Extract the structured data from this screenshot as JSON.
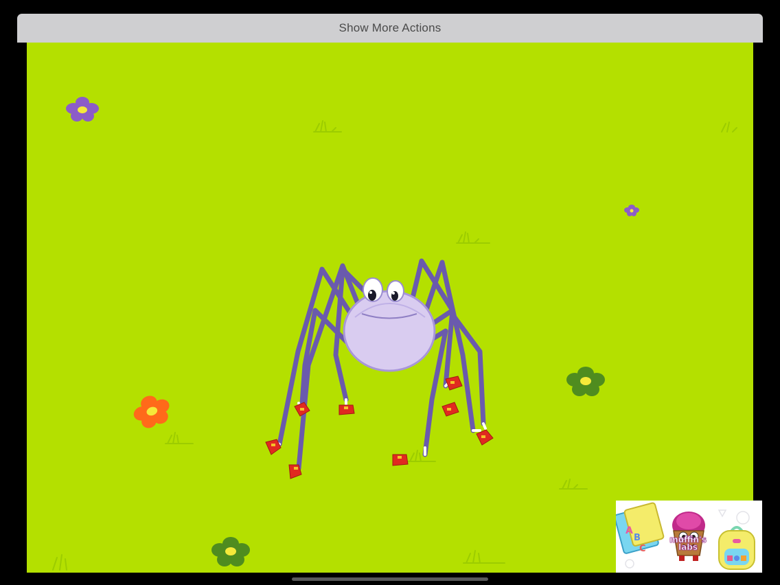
{
  "action_bar": {
    "label": "Show More Actions"
  },
  "video": {
    "scene": "cartoon-spider-on-grass",
    "background_color": "#b4e000"
  },
  "logo": {
    "brand_line1": "muffin's",
    "brand_line2": "labs"
  },
  "colors": {
    "grass": "#b4e000",
    "spider_body": "#d9ccf0",
    "spider_legs": "#6a5aad",
    "shoes": "#e02a20",
    "flower_purple": "#8c5cc8",
    "flower_orange": "#ff6a1a",
    "flower_green": "#4f8c1f"
  }
}
